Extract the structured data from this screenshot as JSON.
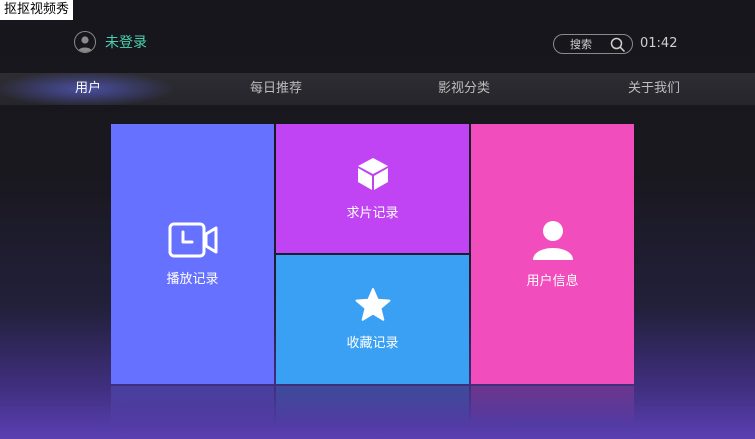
{
  "window": {
    "title": "抠抠视频秀"
  },
  "header": {
    "user_label": "未登录",
    "search_placeholder": "搜索",
    "time": "01:42"
  },
  "nav": {
    "tabs": [
      {
        "label": "用户",
        "active": true
      },
      {
        "label": "每日推荐",
        "active": false
      },
      {
        "label": "影视分类",
        "active": false
      },
      {
        "label": "关于我们",
        "active": false
      }
    ]
  },
  "tiles": {
    "play_history": {
      "label": "播放记录",
      "color": "#6671ff",
      "icon": "video-camera-icon"
    },
    "request_history": {
      "label": "求片记录",
      "color": "#c044f4",
      "icon": "cube-icon"
    },
    "favorites": {
      "label": "收藏记录",
      "color": "#3aa0f3",
      "icon": "star-icon"
    },
    "user_info": {
      "label": "用户信息",
      "color": "#f24dbc",
      "icon": "user-icon"
    }
  },
  "colors": {
    "accent_green": "#48d1b0",
    "nav_glow": "#646eff"
  }
}
